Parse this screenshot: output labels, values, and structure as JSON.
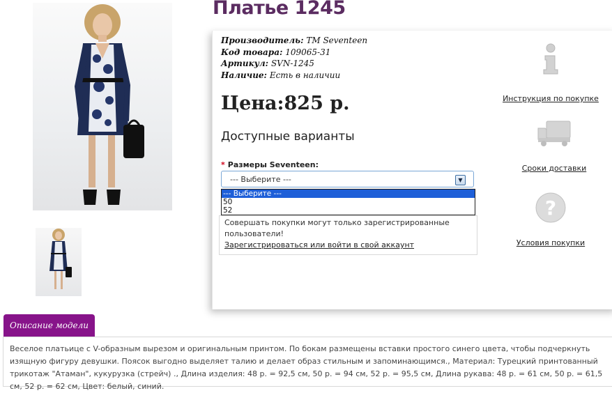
{
  "product": {
    "title": "Платье 1245",
    "meta": [
      {
        "label": "Производитель:",
        "value": "TM Seventeen"
      },
      {
        "label": "Код товара:",
        "value": "109065-31"
      },
      {
        "label": "Артикул:",
        "value": "SVN-1245"
      },
      {
        "label": "Наличие:",
        "value": "Есть в наличии"
      }
    ],
    "price": "Цена:825 р.",
    "variants_heading": "Доступные варианты"
  },
  "size_select": {
    "label": "Размеры Seventeen:",
    "required_mark": "*",
    "selected": "--- Выберите ---",
    "options": [
      "--- Выберите ---",
      "50",
      "52"
    ]
  },
  "notice": {
    "text": "Совершать покупки могут только зарегистрированные пользователи!",
    "link": "Зарегистрироваться или войти в свой аккаунт"
  },
  "sidebar": [
    {
      "icon": "info-icon",
      "label": "Инструкция по покупке"
    },
    {
      "icon": "truck-icon",
      "label": "Сроки доставки"
    },
    {
      "icon": "question-icon",
      "label": "Условия покупки"
    }
  ],
  "description": {
    "tab_label": "Описание модели",
    "text": "Веселое платьице с V-образным вырезом и оригинальным принтом. По бокам размещены вставки простого синего цвета, чтобы подчеркнуть изящную фигуру девушки. Поясок выгодно выделяет талию и делает образ стильным и запоминающимся., Материал: Турецкий принтованный трикотаж \"Атаман\", кукурузка (стрейч) ., Длина изделия: 48 р. = 92,5 см, 50 р. = 94 см, 52 р. = 95,5 см, Длина рукава: 48 р. = 61 см, 50 р. = 61,5 см, 52 р. = 62 см, Цвет: белый, синий."
  },
  "colors": {
    "title": "#5b2c61",
    "tab": "#87148a",
    "selected_option": "#1e5fd8"
  }
}
